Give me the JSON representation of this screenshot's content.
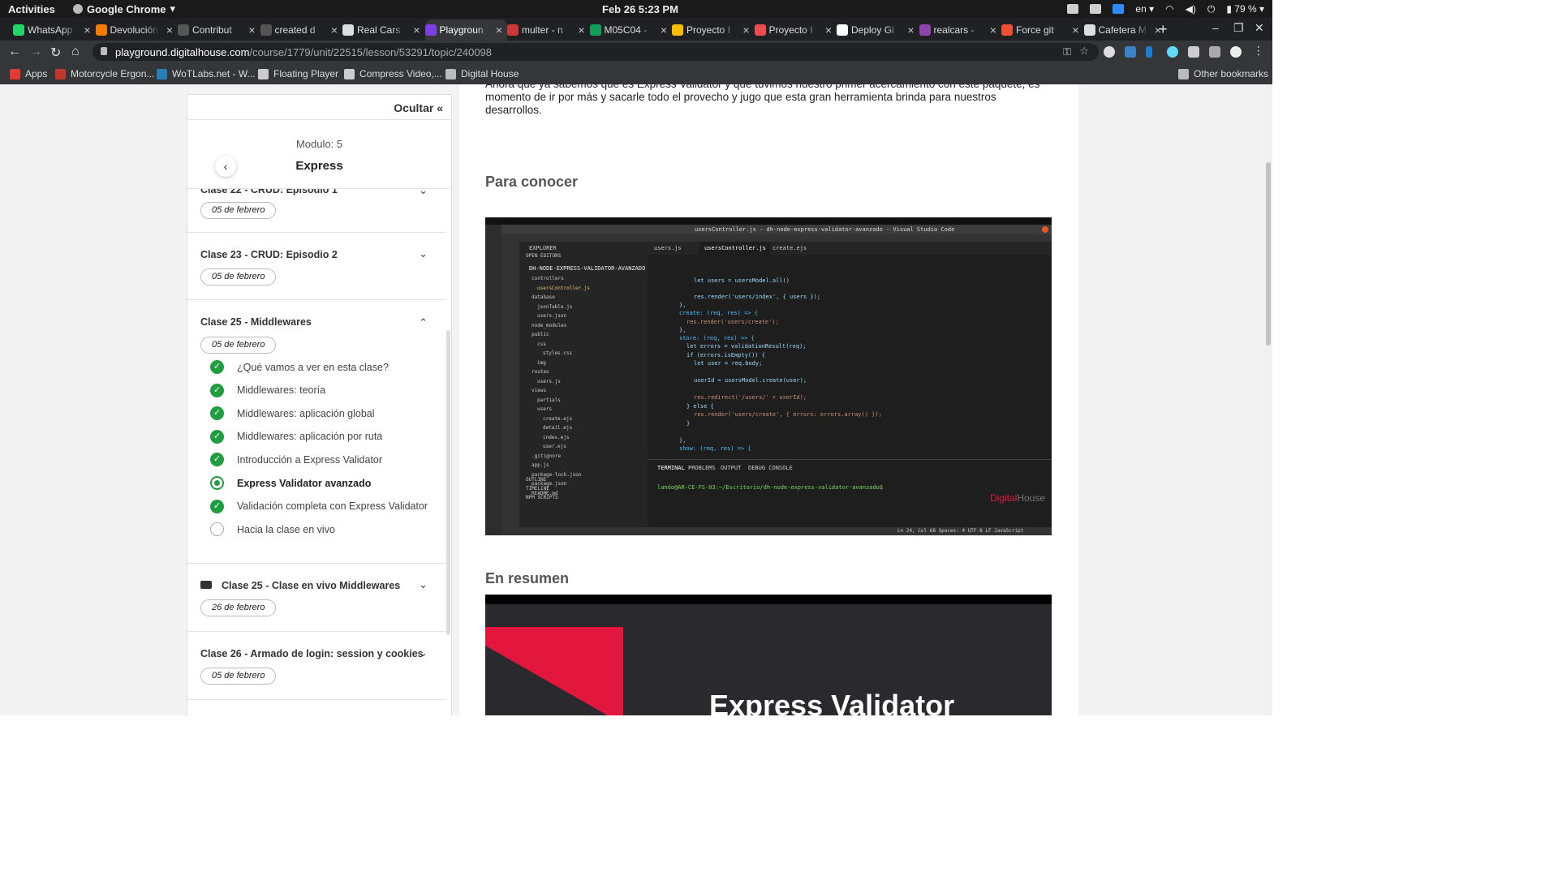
{
  "system": {
    "activities": "Activities",
    "app": "Google Chrome",
    "clock": "Feb 26  5:23 PM",
    "lang": "en",
    "battery": "79 %"
  },
  "tabs": [
    {
      "title": "WhatsApp",
      "color": "#25d366"
    },
    {
      "title": "Devolución",
      "color": "#f57c00"
    },
    {
      "title": "Contribut",
      "color": "#555555"
    },
    {
      "title": "created d",
      "color": "#555555"
    },
    {
      "title": "Real Cars",
      "color": "#dddddd"
    },
    {
      "title": "Playgroun",
      "color": "#7b3fe4",
      "active": true
    },
    {
      "title": "multer - n",
      "color": "#cb3837"
    },
    {
      "title": "M05C04 -",
      "color": "#0f9d58"
    },
    {
      "title": "Proyecto I",
      "color": "#fbbc04"
    },
    {
      "title": "Proyecto I",
      "color": "#e84e4e"
    },
    {
      "title": "Deploy Gi",
      "color": "#ffffff"
    },
    {
      "title": "realcars -",
      "color": "#8e44ad"
    },
    {
      "title": "Force git",
      "color": "#f05032"
    },
    {
      "title": "Cafetera M",
      "color": "#dddddd"
    }
  ],
  "url": {
    "host": "playground.digitalhouse.com",
    "path": "/course/1779/unit/22515/lesson/53291/topic/240098"
  },
  "bookmarks": [
    {
      "label": "Apps",
      "color": "#e53935"
    },
    {
      "label": "Motorcycle Ergon...",
      "color": "#c0392b"
    },
    {
      "label": "WoTLabs.net - W...",
      "color": "#2980b9"
    },
    {
      "label": "Floating Player",
      "color": "#cccccc"
    },
    {
      "label": "Compress Video,...",
      "color": "#cccccc"
    },
    {
      "label": "Digital House",
      "color": "#bbbbbb"
    }
  ],
  "other_bookmarks": "Other bookmarks",
  "sidebar": {
    "hide_label": "Ocultar",
    "module_label": "Modulo: 5",
    "module_title": "Express",
    "classes": [
      {
        "name": "Clase 22 - CRUD: Episodio 1",
        "date": "05 de febrero"
      },
      {
        "name": "Clase 23 - CRUD: Episodio 2",
        "date": "05 de febrero"
      },
      {
        "name": "Clase 25 - Middlewares",
        "date": "05 de febrero",
        "lessons": [
          {
            "label": "¿Qué vamos a ver en esta clase?",
            "status": "done"
          },
          {
            "label": "Middlewares: teoría",
            "status": "done"
          },
          {
            "label": "Middlewares: aplicación global",
            "status": "done"
          },
          {
            "label": "Middlewares: aplicación por ruta",
            "status": "done"
          },
          {
            "label": "Introducción a Express Validator",
            "status": "done"
          },
          {
            "label": "Express Validator avanzado",
            "status": "current"
          },
          {
            "label": "Validación completa con Express Validator",
            "status": "done"
          },
          {
            "label": "Hacia la clase en vivo",
            "status": "todo"
          }
        ]
      },
      {
        "name": "Clase 25 - Clase en vivo Middlewares",
        "date": "26 de febrero"
      },
      {
        "name": "Clase 26 - Armado de login: session y cookies",
        "date": "05 de febrero"
      }
    ]
  },
  "content": {
    "intro": "Ahora que ya sabemos que es Express Validator y que tuvimos nuestro primer acercamiento con este paquete, es momento de ir por más y sacarle todo el provecho y jugo que esta gran herramienta brinda para nuestros desarrollos.",
    "section1": "Para conocer",
    "section2": "En resumen",
    "banner_title": "Express Validator",
    "vscode": {
      "title": "usersController.js - dh-node-express-validator-avanzado - Visual Studio Code",
      "tabs": [
        "users.js",
        "usersController.js",
        "create.ejs"
      ],
      "explorer_title": "EXPLORER",
      "project": "DH-NODE-EXPRESS-VALIDATOR-AVANZADO",
      "files": [
        "OPEN EDITORS",
        "controllers",
        "usersController.js",
        "database",
        "jsonTable.js",
        "users.json",
        "node_modules",
        "public",
        "css",
        "styles.css",
        "img",
        "routes",
        "users.js",
        "views",
        "partials",
        "users",
        "create.ejs",
        "detail.ejs",
        "index.ejs",
        "user.ejs",
        ".gitignore",
        "app.js",
        "package-lock.json",
        "package.json",
        "README.md",
        "OUTLINE",
        "TIMELINE",
        "NPM SCRIPTS"
      ],
      "code": [
        "let users = usersModel.all()",
        "res.render('users/index', { users });",
        "},",
        "create: (req, res) => {",
        "res.render('users/create');",
        "},",
        "store: (req, res) => {",
        "let errors = validationResult(req);",
        "if (errors.isEmpty()) {",
        "let user = req.body;",
        "userId = usersModel.create(user);",
        "res.redirect('/users/' + userId);",
        "} else {",
        "res.render('users/create', { errors: errors.array() });",
        "}",
        "},",
        "show: (req, res) => {"
      ],
      "terminal_tabs": [
        "TERMINAL",
        "PROBLEMS",
        "OUTPUT",
        "DEBUG CONSOLE"
      ],
      "terminal_line": "lando@AR-CE-FS-03:~/Escritorio/dh-node-express-validator-avanzado$",
      "status": "Ln 24, Col 68   Spaces: 4   UTF-8   LF   JavaScript"
    }
  }
}
